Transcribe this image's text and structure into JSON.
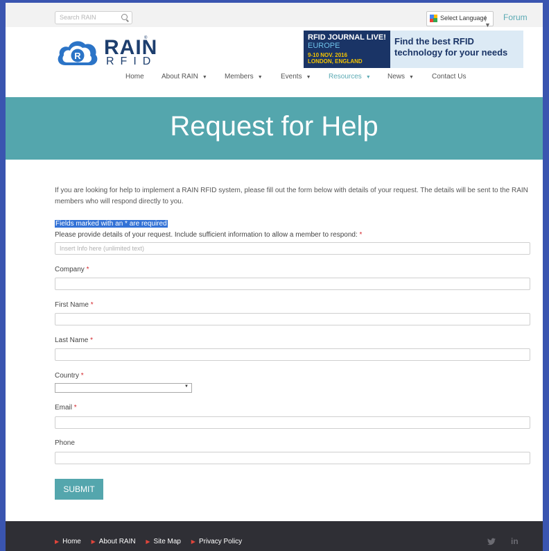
{
  "topbar": {
    "search_placeholder": "Search RAIN",
    "language_label": "Select Language",
    "language_caret": "|  ▼",
    "forum_label": "Forum"
  },
  "logo": {
    "wordmark": "RAIN",
    "sub": "RFID",
    "reg": "®"
  },
  "banner": {
    "journal": "RFID JOURNAL LIVE!",
    "region": "EUROPE",
    "dates": "9-10 NOV. 2016",
    "location": "LONDON, ENGLAND",
    "tagline": "Find the best RFID technology for your needs"
  },
  "nav": {
    "items": [
      {
        "label": "Home"
      },
      {
        "label": "About RAIN"
      },
      {
        "label": "Members"
      },
      {
        "label": "Events"
      },
      {
        "label": "Resources"
      },
      {
        "label": "News"
      },
      {
        "label": "Contact Us"
      }
    ]
  },
  "hero": {
    "title": "Request for Help"
  },
  "content": {
    "intro": "If you are looking for help to implement a RAIN RFID system, please fill out the form below with details of your request.  The details will be sent to the RAIN members who will respond directly to you.",
    "required_note": "Fields marked with an * are required"
  },
  "form": {
    "details_label": "Please provide details of your request. Include sufficient information to allow a member to respond:",
    "details_placeholder": "Insert Info here (unlimited text)",
    "company_label": "Company",
    "first_name_label": "First Name",
    "last_name_label": "Last Name",
    "country_label": "Country",
    "email_label": "Email",
    "phone_label": "Phone",
    "required_mark": "*",
    "submit_label": "SUBMIT"
  },
  "footer": {
    "links": [
      {
        "label": "Home"
      },
      {
        "label": "About RAIN"
      },
      {
        "label": "Site Map"
      },
      {
        "label": "Privacy Policy"
      }
    ],
    "social": [
      "twitter-icon",
      "linkedin-icon"
    ]
  },
  "colors": {
    "accent": "#54a6ad",
    "brand": "#1d3e6e",
    "footer_bg": "#2f2f35",
    "required": "#d3262c"
  }
}
